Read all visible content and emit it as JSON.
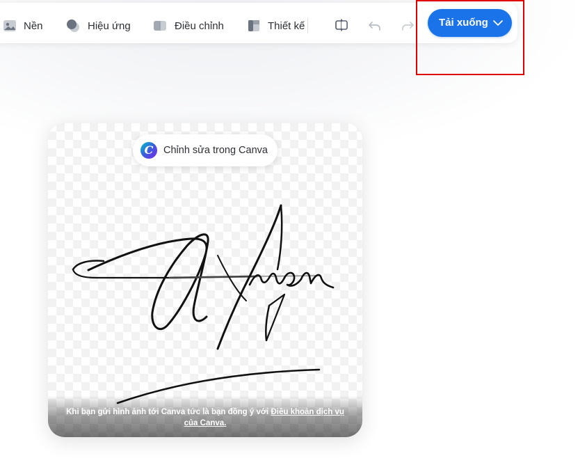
{
  "toolbar": {
    "items": [
      {
        "label": "Nền",
        "icon": "image-icon"
      },
      {
        "label": "Hiệu ứng",
        "icon": "effects-icon"
      },
      {
        "label": "Điều chỉnh",
        "icon": "adjust-icon"
      },
      {
        "label": "Thiết kế",
        "icon": "design-icon"
      }
    ],
    "download_label": "Tải xuống"
  },
  "card": {
    "edit_label": "Chỉnh sửa trong Canva",
    "disclaimer_text": "Khi bạn gửi hình ảnh tới Canva tức là bạn đồng ý với ",
    "disclaimer_link": "Điều khoản dịch vụ của Canva."
  },
  "colors": {
    "accent": "#1a73e8",
    "highlight": "#e00000"
  }
}
